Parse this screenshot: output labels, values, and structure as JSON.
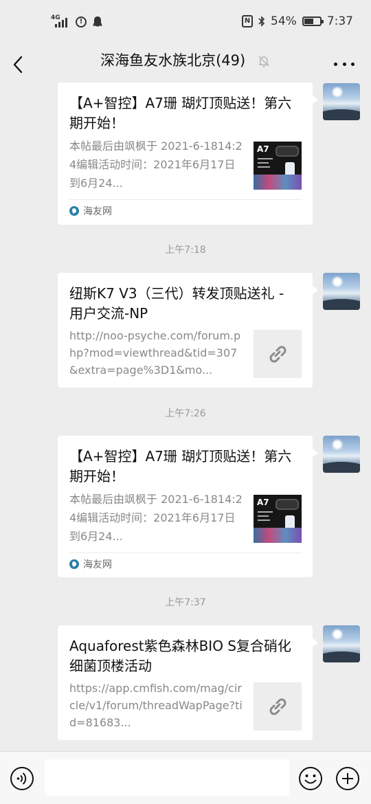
{
  "status_bar": {
    "network": "4G",
    "battery": "54%",
    "time": "7:37"
  },
  "header": {
    "title": "深海鱼友水族北京(49)"
  },
  "messages": [
    {
      "type": "article",
      "title": "【A+智控】A7珊 瑚灯顶贴送！第六期开始！",
      "desc": "本帖最后由飒枫于 2021-6-1814:24编辑活动时间：2021年6月17日到6月24...",
      "source": "海友网",
      "thumb_label": "A7"
    },
    {
      "type": "timestamp",
      "text": "上午7:18"
    },
    {
      "type": "link",
      "title": "纽斯K7 V3（三代）转发顶贴送礼 - 用户交流-NP",
      "desc": "http://noo-psyche.com/forum.php?mod=viewthread&tid=307&extra=page%3D1&mo..."
    },
    {
      "type": "timestamp",
      "text": "上午7:26"
    },
    {
      "type": "article",
      "title": "【A+智控】A7珊 瑚灯顶贴送！第六期开始！",
      "desc": "本帖最后由飒枫于 2021-6-1814:24编辑活动时间：2021年6月17日到6月24...",
      "source": "海友网",
      "thumb_label": "A7"
    },
    {
      "type": "timestamp",
      "text": "上午7:37"
    },
    {
      "type": "link",
      "title": "Aquaforest紫色森林BIO S复合硝化细菌顶楼活动",
      "desc": "https://app.cmfish.com/mag/circle/v1/forum/threadWapPage?tid=81683..."
    }
  ],
  "input_bar": {
    "value": ""
  },
  "colors": {
    "background": "#ededed",
    "card": "#ffffff",
    "secondary_text": "#888888",
    "timestamp": "#999999"
  }
}
